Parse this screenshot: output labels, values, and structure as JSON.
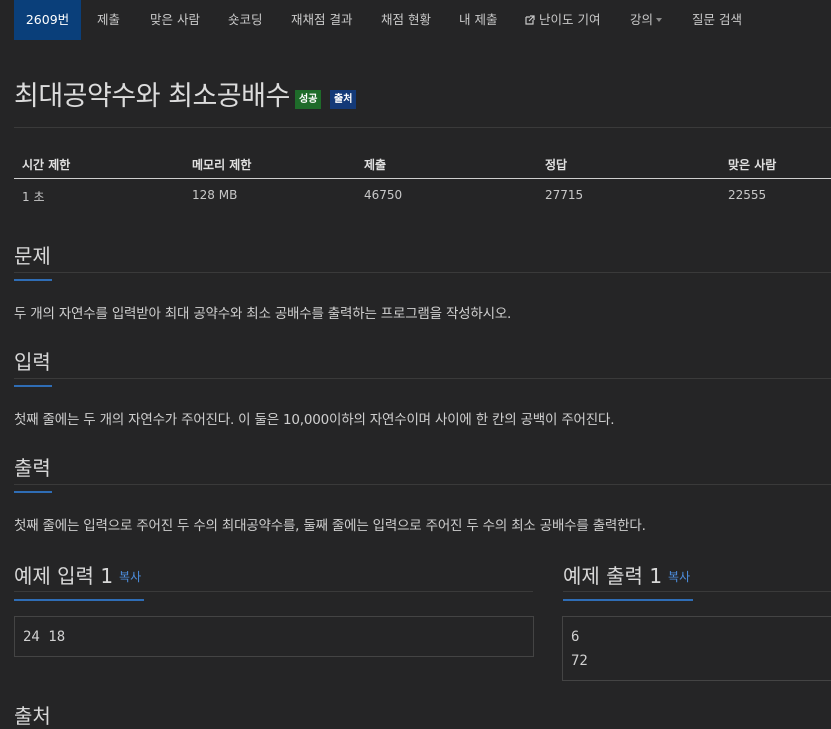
{
  "nav": {
    "items": [
      {
        "label": "2609번"
      },
      {
        "label": "제출"
      },
      {
        "label": "맞은 사람"
      },
      {
        "label": "숏코딩"
      },
      {
        "label": "재채점 결과"
      },
      {
        "label": "채점 현황"
      },
      {
        "label": "내 제출"
      },
      {
        "label": "난이도 기여",
        "icon": "external-link-icon"
      },
      {
        "label": "강의",
        "icon": "caret-down-icon"
      },
      {
        "label": "질문 검색"
      }
    ]
  },
  "problem": {
    "title": "최대공약수와 최소공배수",
    "badges": [
      "성공",
      "출처"
    ],
    "badge_colors": {
      "success": "#1e6b2a",
      "source": "#143a78"
    }
  },
  "info_table": {
    "headers": [
      "시간 제한",
      "메모리 제한",
      "제출",
      "정답",
      "맞은 사람"
    ],
    "row": [
      "1 초",
      "128 MB",
      "46750",
      "27715",
      "22555"
    ]
  },
  "sections": {
    "problem": {
      "heading": "문제",
      "text": "두 개의 자연수를 입력받아 최대 공약수와 최소 공배수를 출력하는 프로그램을 작성하시오."
    },
    "input": {
      "heading": "입력",
      "text": "첫째 줄에는 두 개의 자연수가 주어진다. 이 둘은 10,000이하의 자연수이며 사이에 한 칸의 공백이 주어진다."
    },
    "output": {
      "heading": "출력",
      "text": "첫째 줄에는 입력으로 주어진 두 수의 최대공약수를, 둘째 줄에는 입력으로 주어진 두 수의 최소 공배수를 출력한다."
    },
    "sample_input": {
      "heading": "예제 입력 1",
      "copy": "복사",
      "content": "24 18"
    },
    "sample_output": {
      "heading": "예제 출력 1",
      "copy": "복사",
      "content": "6\n72"
    },
    "next_heading": "출처"
  },
  "colors": {
    "accent": "#2f6db5",
    "active_tab": "#0a3f7a",
    "link": "#4d8fe0"
  }
}
